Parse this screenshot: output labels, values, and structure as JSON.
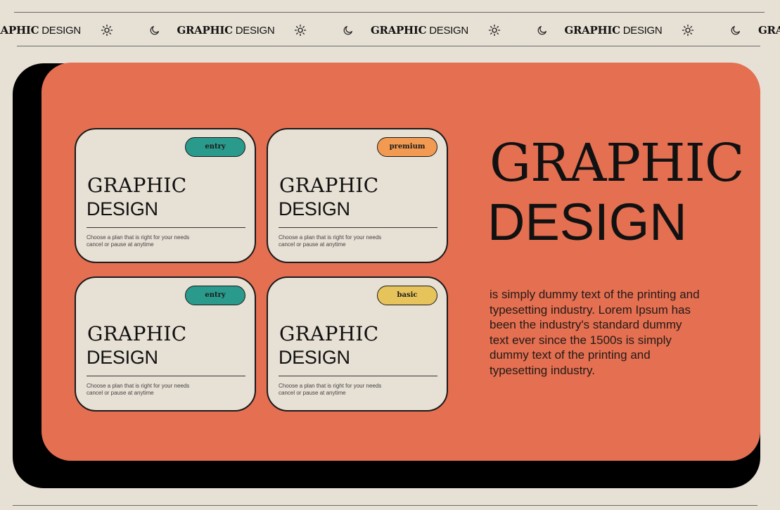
{
  "marquee": {
    "brand_bold": "GRAPHIC",
    "brand_light": "DESIGN",
    "repeat_count": 5,
    "icons": [
      "moon-icon",
      "sun-icon"
    ]
  },
  "plans": [
    {
      "badge": "entry",
      "badge_color": "#2a9a8c",
      "title": "GRAPHIC",
      "subtitle": "DESIGN",
      "note_line1": "Choose a plan that is right for your needs",
      "note_line2": "cancel or pause at anytime"
    },
    {
      "badge": "premium",
      "badge_color": "#f39a52",
      "title": "GRAPHIC",
      "subtitle": "DESIGN",
      "note_line1": "Choose a plan that is right for your needs",
      "note_line2": "cancel or pause at anytime"
    },
    {
      "badge": "entry",
      "badge_color": "#2a9a8c",
      "title": "GRAPHIC",
      "subtitle": "DESIGN",
      "note_line1": "Choose a plan that is right for your needs",
      "note_line2": "cancel or pause at anytime"
    },
    {
      "badge": "basic",
      "badge_color": "#e7c35b",
      "title": "GRAPHIC",
      "subtitle": "DESIGN",
      "note_line1": "Choose a plan that is right for your needs",
      "note_line2": "cancel or pause at anytime"
    }
  ],
  "hero": {
    "title": "GRAPHIC",
    "subtitle": "DESIGN",
    "body": " is simply dummy text of the printing and typesetting industry. Lorem Ipsum has been the industry's standard dummy text ever since the 1500s is simply dummy text of the printing and typesetting industry."
  },
  "colors": {
    "page_background": "#e7e0d5",
    "panel_accent": "#e46f51",
    "panel_shadow": "#000000",
    "teal": "#2a9a8c",
    "orange": "#f39a52",
    "yellow": "#e7c35b"
  }
}
